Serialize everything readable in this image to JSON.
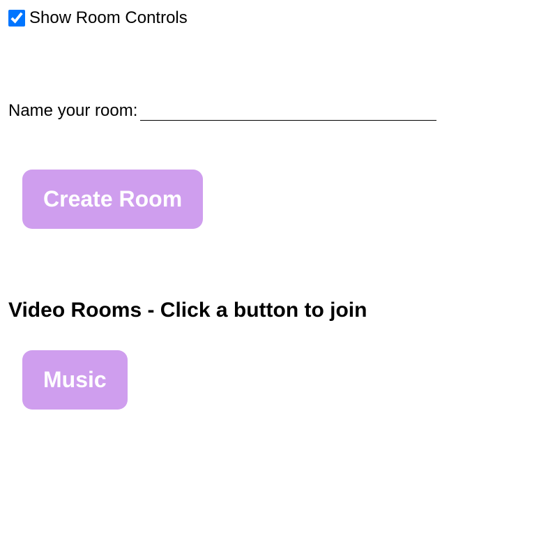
{
  "controls": {
    "show_room_controls_label": "Show Room Controls",
    "show_room_controls_checked": true
  },
  "form": {
    "name_label": "Name your room:",
    "name_value": "",
    "create_button_label": "Create Room"
  },
  "rooms_section": {
    "heading": "Video Rooms - Click a button to join",
    "rooms": [
      {
        "label": "Music"
      }
    ]
  },
  "colors": {
    "button_bg": "#cf9eee",
    "button_fg": "#ffffff",
    "checkbox_accent": "#0075ff"
  }
}
